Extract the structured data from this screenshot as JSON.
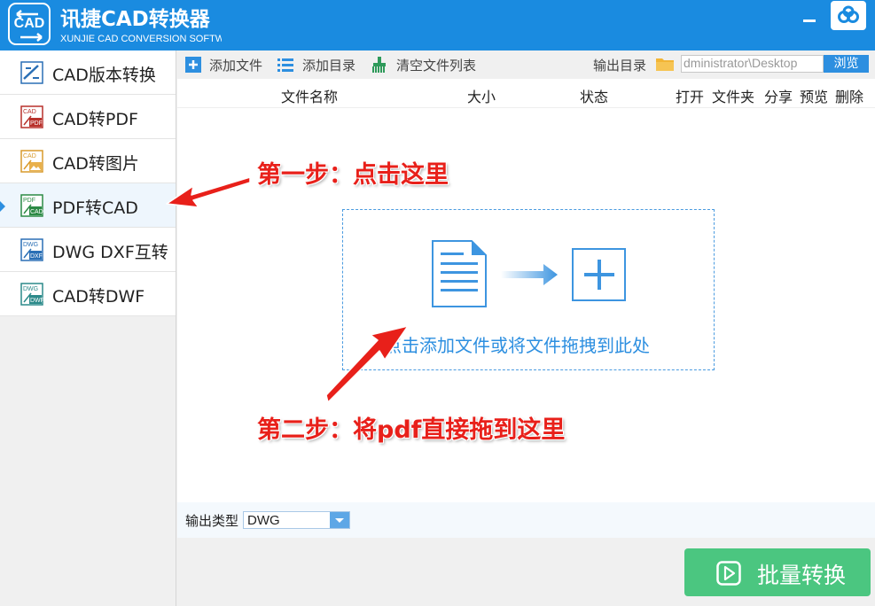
{
  "app": {
    "title": "讯捷CAD转换器",
    "subtitle": "XUNJIE CAD CONVERSION SOFTWARE",
    "logo_text": "CAD"
  },
  "sidebar": {
    "items": [
      {
        "label": "CAD版本转换",
        "icon": "cad-version-icon"
      },
      {
        "label": "CAD转PDF",
        "icon": "cad-to-pdf-icon"
      },
      {
        "label": "CAD转图片",
        "icon": "cad-to-image-icon"
      },
      {
        "label": "PDF转CAD",
        "icon": "pdf-to-cad-icon",
        "active": true
      },
      {
        "label": "DWG DXF互转",
        "icon": "dwg-dxf-icon"
      },
      {
        "label": "CAD转DWF",
        "icon": "cad-to-dwf-icon"
      }
    ]
  },
  "toolbar": {
    "add_file": "添加文件",
    "add_folder": "添加目录",
    "clear_list": "清空文件列表",
    "output_dir_label": "输出目录",
    "output_path": "dministrator\\Desktop",
    "browse": "浏览"
  },
  "table": {
    "columns": {
      "name": "文件名称",
      "size": "大小",
      "status": "状态",
      "open": "打开",
      "folder": "文件夹",
      "share": "分享",
      "preview": "预览",
      "delete": "删除"
    }
  },
  "dropzone": {
    "text": "点击添加文件或将文件拖拽到此处"
  },
  "output_type": {
    "label": "输出类型",
    "value": "DWG"
  },
  "convert_button": "批量转换",
  "annotations": {
    "step1": "第一步：点击这里",
    "step2": "第二步：将pdf直接拖到这里"
  },
  "colors": {
    "titlebar": "#1a8be0",
    "accent": "#2d8fe0",
    "convert": "#4bc680",
    "annotation": "#e8201a"
  }
}
